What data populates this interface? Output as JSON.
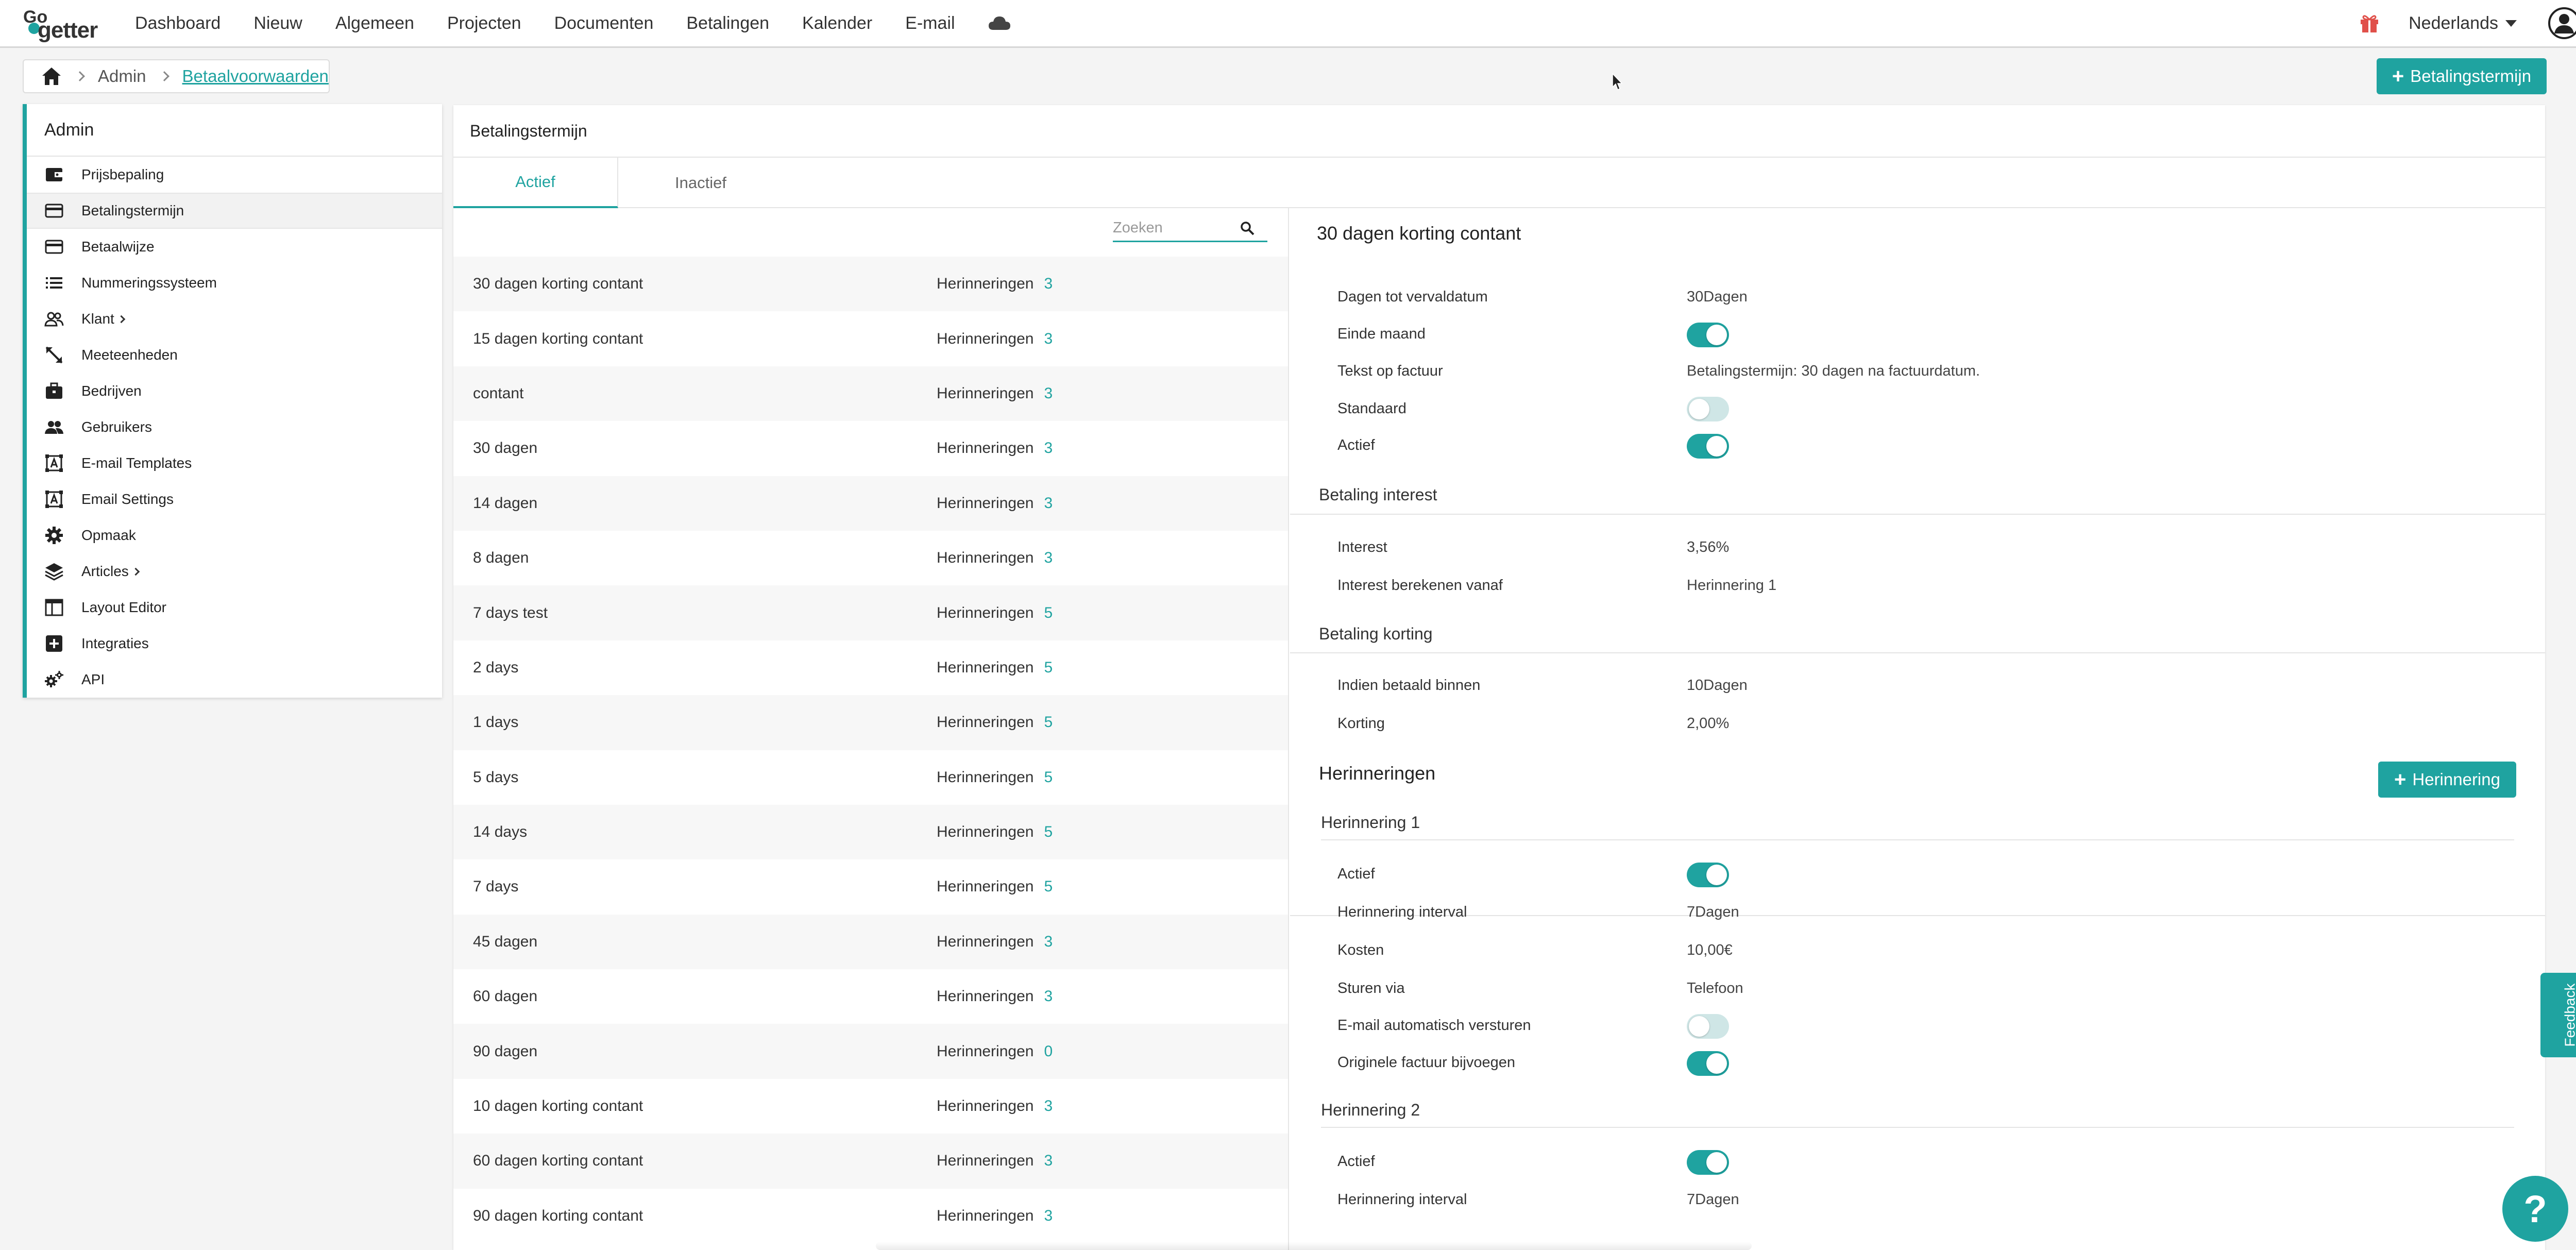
{
  "app": {
    "logo_text_top": "Go",
    "logo_text_main": "getter"
  },
  "nav": {
    "items": [
      "Dashboard",
      "Nieuw",
      "Algemeen",
      "Projecten",
      "Documenten",
      "Betalingen",
      "Kalender",
      "E-mail"
    ],
    "icons": [
      "cloud-icon",
      "gift-icon",
      "user-icon"
    ],
    "language": "Nederlands"
  },
  "breadcrumb": {
    "items": [
      "Admin"
    ],
    "current": "Betaalvoorwaarden"
  },
  "actions": {
    "add_term_label": "Betalingstermijn",
    "add_reminder_label": "Herinnering"
  },
  "sidebar": {
    "title": "Admin",
    "items": [
      {
        "label": "Prijsbepaling",
        "icon": "wallet-icon"
      },
      {
        "label": "Betalingstermijn",
        "icon": "credit-card-icon"
      },
      {
        "label": "Betaalwijze",
        "icon": "credit-card-icon"
      },
      {
        "label": "Nummeringssysteem",
        "icon": "list-icon"
      },
      {
        "label": "Klant",
        "icon": "users-icon"
      },
      {
        "label": "Meeteenheden",
        "icon": "resize-icon"
      },
      {
        "label": "Bedrijven",
        "icon": "briefcase-icon"
      },
      {
        "label": "Gebruikers",
        "icon": "people-icon"
      },
      {
        "label": "E-mail Templates",
        "icon": "template-icon"
      },
      {
        "label": "Email Settings",
        "icon": "template-icon"
      },
      {
        "label": "Opmaak",
        "icon": "gear-icon"
      },
      {
        "label": "Articles",
        "icon": "layers-icon"
      },
      {
        "label": "Layout Editor",
        "icon": "layout-icon"
      },
      {
        "label": "Integraties",
        "icon": "plus-box-icon"
      },
      {
        "label": "API",
        "icon": "gears-icon"
      }
    ],
    "active_index": 1
  },
  "main": {
    "title": "Betalingstermijn",
    "tabs": [
      {
        "label": "Actief"
      },
      {
        "label": "Inactief"
      }
    ],
    "search_placeholder": "Zoeken",
    "rows": [
      {
        "name": "30 dagen korting contant",
        "reminders_label": "Herinneringen",
        "count": "3"
      },
      {
        "name": "15 dagen korting contant",
        "reminders_label": "Herinneringen",
        "count": "3"
      },
      {
        "name": "contant",
        "reminders_label": "Herinneringen",
        "count": "3"
      },
      {
        "name": "30 dagen",
        "reminders_label": "Herinneringen",
        "count": "3"
      },
      {
        "name": "14 dagen",
        "reminders_label": "Herinneringen",
        "count": "3"
      },
      {
        "name": "8 dagen",
        "reminders_label": "Herinneringen",
        "count": "3"
      },
      {
        "name": "7 days test",
        "reminders_label": "Herinneringen",
        "count": "5"
      },
      {
        "name": "2 days",
        "reminders_label": "Herinneringen",
        "count": "5"
      },
      {
        "name": "1 days",
        "reminders_label": "Herinneringen",
        "count": "5"
      },
      {
        "name": "5 days",
        "reminders_label": "Herinneringen",
        "count": "5"
      },
      {
        "name": "14 days",
        "reminders_label": "Herinneringen",
        "count": "5"
      },
      {
        "name": "7 days",
        "reminders_label": "Herinneringen",
        "count": "5"
      },
      {
        "name": "45 dagen",
        "reminders_label": "Herinneringen",
        "count": "3"
      },
      {
        "name": "60 dagen",
        "reminders_label": "Herinneringen",
        "count": "3"
      },
      {
        "name": "90 dagen",
        "reminders_label": "Herinneringen",
        "count": "0"
      },
      {
        "name": "10 dagen korting contant",
        "reminders_label": "Herinneringen",
        "count": "3"
      },
      {
        "name": "60 dagen korting contant",
        "reminders_label": "Herinneringen",
        "count": "3"
      },
      {
        "name": "90 dagen korting contant",
        "reminders_label": "Herinneringen",
        "count": "3"
      }
    ]
  },
  "detail": {
    "title": "30 dagen korting contant",
    "fields": [
      {
        "label": "Dagen tot vervaldatum",
        "value": "30Dagen"
      },
      {
        "label": "Einde maand",
        "toggle": true
      },
      {
        "label": "Tekst op factuur",
        "value": "Betalingstermijn: 30 dagen na factuurdatum."
      },
      {
        "label": "Standaard",
        "toggle": false
      },
      {
        "label": "Actief",
        "toggle": true
      }
    ],
    "interest": {
      "title": "Betaling interest",
      "fields": [
        {
          "label": "Interest",
          "value": "3,56%"
        },
        {
          "label": "Interest berekenen vanaf",
          "value": "Herinnering 1"
        }
      ]
    },
    "discount": {
      "title": "Betaling korting",
      "fields": [
        {
          "label": "Indien betaald binnen",
          "value": "10Dagen"
        },
        {
          "label": "Korting",
          "value": "2,00%"
        }
      ]
    },
    "reminders": {
      "title": "Herinneringen",
      "items": [
        {
          "title": "Herinnering 1",
          "fields": [
            {
              "label": "Actief",
              "toggle": true
            },
            {
              "label": "Herinnering interval",
              "value": "7Dagen"
            },
            {
              "label": "Kosten",
              "value": "10,00€"
            },
            {
              "label": "Sturen via",
              "value": "Telefoon"
            },
            {
              "label": "E-mail automatisch versturen",
              "toggle": false
            },
            {
              "label": "Originele factuur bijvoegen",
              "toggle": true
            }
          ]
        },
        {
          "title": "Herinnering 2",
          "fields": [
            {
              "label": "Actief",
              "toggle": true
            },
            {
              "label": "Herinnering interval",
              "value": "7Dagen"
            }
          ]
        }
      ]
    }
  },
  "floating": {
    "feedback_label": "Feedback",
    "help_label": "?"
  },
  "colors": {
    "accent": "#1fa3a0",
    "gift": "#e0504a"
  }
}
